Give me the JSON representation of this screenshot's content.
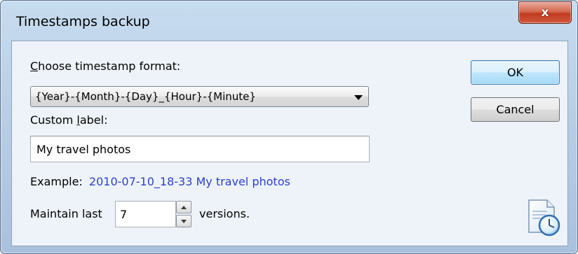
{
  "window": {
    "title": "Timestamps backup",
    "close_label": "x"
  },
  "format": {
    "label_prefix": "C",
    "label_rest": "hoose timestamp format:",
    "selected": "{Year}-{Month}-{Day}_{Hour}-{Minute}"
  },
  "custom_label": {
    "label_prefix": "Custom ",
    "label_accel": "l",
    "label_rest": "abel:",
    "value": "My travel photos"
  },
  "example": {
    "label": "Example:",
    "value": "2010-07-10_18-33 My travel photos"
  },
  "maintain": {
    "label_before": "Maintain last",
    "value": "7",
    "label_after": "versions."
  },
  "buttons": {
    "ok": "OK",
    "cancel": "Cancel"
  },
  "colors": {
    "example_value": "#2b3fd0",
    "client_background": "#eef3f9"
  },
  "icons": {
    "backup": "document-clock-icon"
  }
}
